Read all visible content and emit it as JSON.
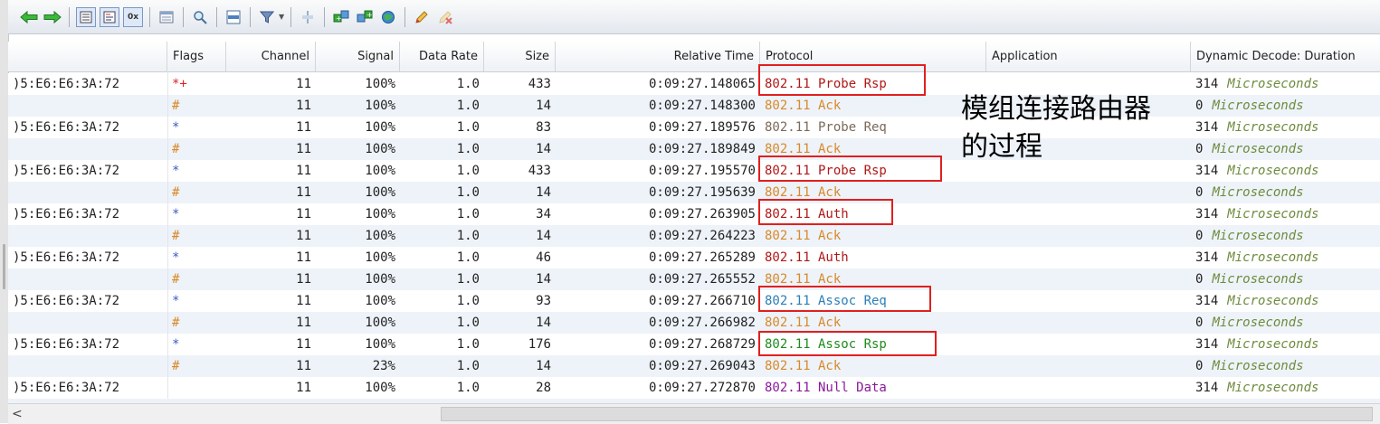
{
  "columns": {
    "source": "",
    "flags": "Flags",
    "channel": "Channel",
    "signal": "Signal",
    "data_rate": "Data Rate",
    "size": "Size",
    "relative_time": "Relative Time",
    "protocol": "Protocol",
    "application": "Application",
    "duration": "Dynamic Decode: Duration"
  },
  "colors": {
    "probe_rsp": "#b01818",
    "ack": "#d8892a",
    "probe_req": "#7a6a5a",
    "auth": "#b01818",
    "assoc_req": "#2a7fb8",
    "assoc_rsp": "#1f8a1f",
    "null_data": "#8a1a9a",
    "flag_red": "#e02020",
    "flag_blue": "#3a5bbf",
    "flag_orange": "#d8892a",
    "duration_unit": "#6e8b3d"
  },
  "rows": [
    {
      "source": ")5:E6:E6:3A:72",
      "flags": "*+",
      "flag_color": "#e02020",
      "channel": "11",
      "signal": "100%",
      "data_rate": "1.0",
      "size": "433",
      "time": "0:09:27.148065",
      "protocol": "802.11 Probe Rsp",
      "protocol_color": "#b01818",
      "duration": "314",
      "unit": "Microseconds"
    },
    {
      "source": "",
      "flags": "#",
      "flag_color": "#d8892a",
      "channel": "11",
      "signal": "100%",
      "data_rate": "1.0",
      "size": "14",
      "time": "0:09:27.148300",
      "protocol": "802.11 Ack",
      "protocol_color": "#d8892a",
      "duration": "0",
      "unit": "Microseconds"
    },
    {
      "source": ")5:E6:E6:3A:72",
      "flags": "*",
      "flag_color": "#3a5bbf",
      "channel": "11",
      "signal": "100%",
      "data_rate": "1.0",
      "size": "83",
      "time": "0:09:27.189576",
      "protocol": "802.11 Probe Req",
      "protocol_color": "#7a6a5a",
      "duration": "314",
      "unit": "Microseconds"
    },
    {
      "source": "",
      "flags": "#",
      "flag_color": "#d8892a",
      "channel": "11",
      "signal": "100%",
      "data_rate": "1.0",
      "size": "14",
      "time": "0:09:27.189849",
      "protocol": "802.11 Ack",
      "protocol_color": "#d8892a",
      "duration": "0",
      "unit": "Microseconds"
    },
    {
      "source": ")5:E6:E6:3A:72",
      "flags": "*",
      "flag_color": "#3a5bbf",
      "channel": "11",
      "signal": "100%",
      "data_rate": "1.0",
      "size": "433",
      "time": "0:09:27.195570",
      "protocol": "802.11 Probe Rsp",
      "protocol_color": "#b01818",
      "duration": "314",
      "unit": "Microseconds"
    },
    {
      "source": "",
      "flags": "#",
      "flag_color": "#d8892a",
      "channel": "11",
      "signal": "100%",
      "data_rate": "1.0",
      "size": "14",
      "time": "0:09:27.195639",
      "protocol": "802.11 Ack",
      "protocol_color": "#d8892a",
      "duration": "0",
      "unit": "Microseconds"
    },
    {
      "source": ")5:E6:E6:3A:72",
      "flags": "*",
      "flag_color": "#3a5bbf",
      "channel": "11",
      "signal": "100%",
      "data_rate": "1.0",
      "size": "34",
      "time": "0:09:27.263905",
      "protocol": "802.11 Auth",
      "protocol_color": "#b01818",
      "duration": "314",
      "unit": "Microseconds"
    },
    {
      "source": "",
      "flags": "#",
      "flag_color": "#d8892a",
      "channel": "11",
      "signal": "100%",
      "data_rate": "1.0",
      "size": "14",
      "time": "0:09:27.264223",
      "protocol": "802.11 Ack",
      "protocol_color": "#d8892a",
      "duration": "0",
      "unit": "Microseconds"
    },
    {
      "source": ")5:E6:E6:3A:72",
      "flags": "*",
      "flag_color": "#3a5bbf",
      "channel": "11",
      "signal": "100%",
      "data_rate": "1.0",
      "size": "46",
      "time": "0:09:27.265289",
      "protocol": "802.11 Auth",
      "protocol_color": "#b01818",
      "duration": "314",
      "unit": "Microseconds"
    },
    {
      "source": "",
      "flags": "#",
      "flag_color": "#d8892a",
      "channel": "11",
      "signal": "100%",
      "data_rate": "1.0",
      "size": "14",
      "time": "0:09:27.265552",
      "protocol": "802.11 Ack",
      "protocol_color": "#d8892a",
      "duration": "0",
      "unit": "Microseconds"
    },
    {
      "source": ")5:E6:E6:3A:72",
      "flags": "*",
      "flag_color": "#3a5bbf",
      "channel": "11",
      "signal": "100%",
      "data_rate": "1.0",
      "size": "93",
      "time": "0:09:27.266710",
      "protocol": "802.11 Assoc Req",
      "protocol_color": "#2a7fb8",
      "duration": "314",
      "unit": "Microseconds"
    },
    {
      "source": "",
      "flags": "#",
      "flag_color": "#d8892a",
      "channel": "11",
      "signal": "100%",
      "data_rate": "1.0",
      "size": "14",
      "time": "0:09:27.266982",
      "protocol": "802.11 Ack",
      "protocol_color": "#d8892a",
      "duration": "0",
      "unit": "Microseconds"
    },
    {
      "source": ")5:E6:E6:3A:72",
      "flags": "*",
      "flag_color": "#3a5bbf",
      "channel": "11",
      "signal": "100%",
      "data_rate": "1.0",
      "size": "176",
      "time": "0:09:27.268729",
      "protocol": "802.11 Assoc Rsp",
      "protocol_color": "#1f8a1f",
      "duration": "314",
      "unit": "Microseconds"
    },
    {
      "source": "",
      "flags": "#",
      "flag_color": "#d8892a",
      "channel": "11",
      "signal": "23%",
      "data_rate": "1.0",
      "size": "14",
      "time": "0:09:27.269043",
      "protocol": "802.11 Ack",
      "protocol_color": "#d8892a",
      "duration": "0",
      "unit": "Microseconds"
    },
    {
      "source": ")5:E6:E6:3A:72",
      "flags": "",
      "flag_color": "#3a5bbf",
      "channel": "11",
      "signal": "100%",
      "data_rate": "1.0",
      "size": "28",
      "time": "0:09:27.272870",
      "protocol": "802.11 Null Data",
      "protocol_color": "#8a1a9a",
      "duration": "314",
      "unit": "Microseconds"
    }
  ],
  "annotation": {
    "line1": "模组连接路由器",
    "line2": "的过程"
  },
  "scrollbar": {
    "left_arrow": "<"
  },
  "toolbar_icons": [
    "back-arrow-icon",
    "forward-arrow-icon",
    "list-view-icon",
    "detail-view-icon",
    "hex-view-icon",
    "packet-list-icon",
    "search-icon",
    "layout-icon",
    "filter-icon",
    "columns-icon",
    "add-node-icon",
    "add-node-2-icon",
    "network-icon",
    "edit-icon",
    "clear-icon"
  ],
  "toolbar_hex_label": "0x"
}
